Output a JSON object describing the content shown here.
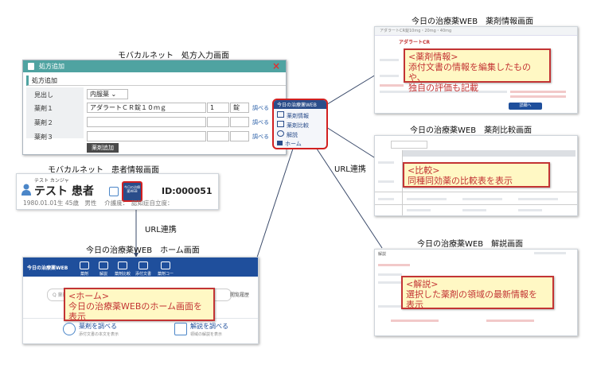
{
  "labels": {
    "prescription_screen": "モバカルネット　処方入力画面",
    "patient_screen": "モバカルネット　患者情報画面",
    "home_screen": "今日の治療薬WEB　ホーム画面",
    "drug_info_screen": "今日の治療薬WEB　薬剤情報画面",
    "drug_compare_screen": "今日の治療薬WEB　薬剤比較画面",
    "explanation_screen": "今日の治療薬WEB　解説画面",
    "url_link_top": "URL連携",
    "url_link_mid": "URL連携"
  },
  "prescription": {
    "window_title": "処方追加",
    "section_title": "処方追加",
    "rows": [
      {
        "label": "見出し",
        "value": "内服薬 ⌄"
      },
      {
        "label": "薬剤１",
        "value": "アダラートＣＲ錠１０ｍｇ",
        "qty": "1",
        "unit": "錠",
        "link": "調べる"
      },
      {
        "label": "薬剤２",
        "value": "",
        "link": "調べる"
      },
      {
        "label": "薬剤３",
        "value": "",
        "link": "調べる"
      }
    ],
    "add_button": "薬剤追加",
    "close_glyph": "×"
  },
  "popup_menu": {
    "title": "今日の治療薬WEB",
    "items": [
      "薬剤情報",
      "薬剤比較",
      "解説",
      "ホーム"
    ]
  },
  "patient": {
    "kana": "テスト カンジャ",
    "name": "テスト 患者",
    "id": "ID:000051",
    "dob_line": "1980.01.01生 45歳　男性　 介護度：　認知症自立度：",
    "button_label": "今日の治療薬WEB"
  },
  "home": {
    "logo": "今日の治療薬WEB",
    "nav": [
      "薬剤",
      "解説",
      "薬剤比較",
      "添付文書",
      "薬剤コード"
    ],
    "search_placeholder": "Q 薬剤・解説を検索",
    "history_label": "閲覧履歴",
    "card1_title": "薬剤を調べる",
    "card1_sub": "添付文書の本文を表示",
    "card2_title": "解説を調べる",
    "card2_sub": "領域の解説を表示"
  },
  "drug_info": {
    "drug_name": "アダラートCR",
    "header_text": "アダラートCR錠10mg・20mg・40mg",
    "button": "詳細へ"
  },
  "explanation": {
    "title": "解説"
  },
  "callouts": {
    "home": [
      "<ホーム>",
      "今日の治療薬WEBのホーム画面を",
      "表示"
    ],
    "drug_info": [
      "<薬剤情報>",
      "添付文書の情報を編集したものや、",
      "独自の評価も記載"
    ],
    "compare": [
      "<比較>",
      "同種同効薬の比較表を表示"
    ],
    "explanation": [
      "<解説>",
      "選択した薬剤の領域の最新情報を",
      "表示"
    ]
  },
  "colors": {
    "callout_border": "#c33434",
    "callout_fill": "#fff8c4",
    "teal_header": "#4fa3a1",
    "nav_blue": "#1f4f9c",
    "highlight_red": "#d22020"
  }
}
